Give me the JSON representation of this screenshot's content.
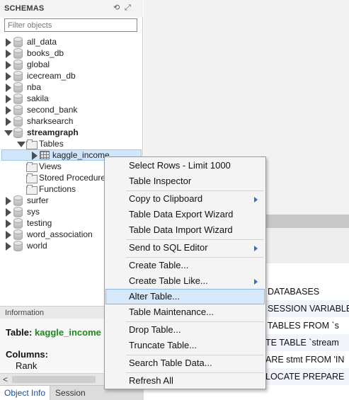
{
  "schemas_panel": {
    "title": "SCHEMAS",
    "filter_placeholder": "Filter objects",
    "schemas": [
      "all_data",
      "books_db",
      "global",
      "icecream_db",
      "nba",
      "sakila",
      "second_bank",
      "sharksearch",
      "streamgraph",
      "surfer",
      "sys",
      "testing",
      "word_association",
      "world"
    ],
    "expanded_schema": "streamgraph",
    "tables_label": "Tables",
    "selected_table": "kaggle_income",
    "views_label": "Views",
    "stored_procedures_label": "Stored Procedures",
    "functions_label": "Functions"
  },
  "info_panel": {
    "title": "Information",
    "table_label": "Table:",
    "table_value": "kaggle_income",
    "columns_label": "Columns:",
    "columns": [
      "Rank"
    ]
  },
  "bottom_tabs": [
    "Object Info",
    "Session"
  ],
  "output_lines": [
    "/ DATABASES",
    "/ SESSION VARIABLES",
    "/ TABLES FROM `s",
    "TE TABLE `stream",
    "ARE stmt FROM 'IN",
    "LOCATE PREPARE"
  ],
  "context_menu": {
    "items": [
      "Select Rows - Limit 1000",
      "Table Inspector",
      "Copy to Clipboard",
      "Table Data Export Wizard",
      "Table Data Import Wizard",
      "Send to SQL Editor",
      "Create Table...",
      "Create Table Like...",
      "Alter Table...",
      "Table Maintenance...",
      "Drop Table...",
      "Truncate Table...",
      "Search Table Data...",
      "Refresh All"
    ],
    "hovered_item": "Alter Table..."
  }
}
